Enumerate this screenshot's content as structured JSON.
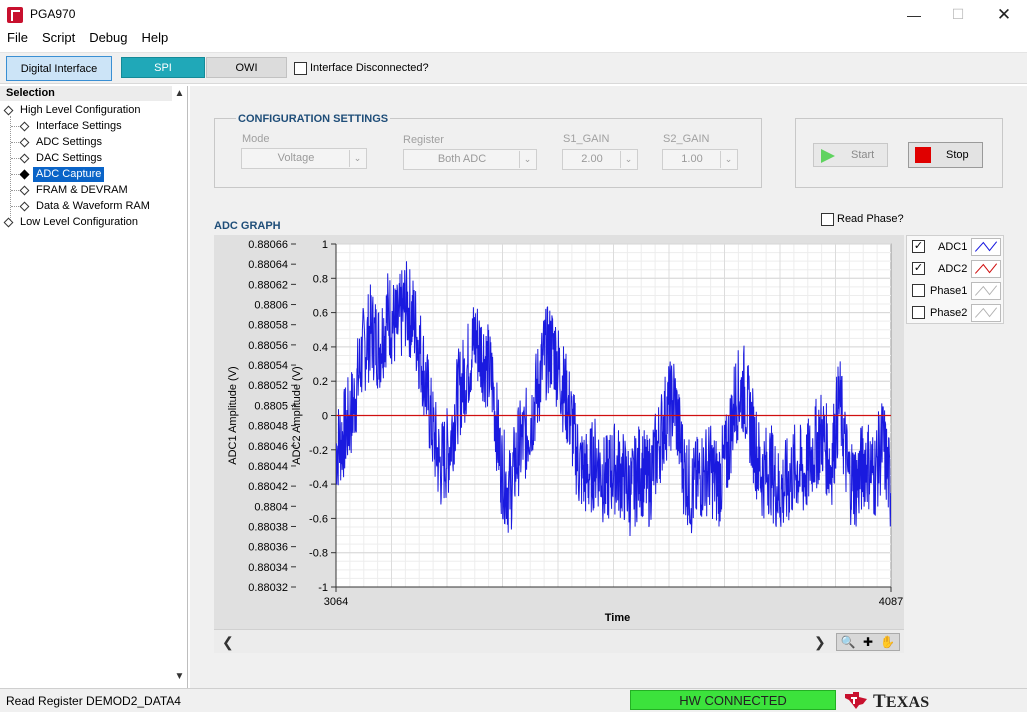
{
  "window": {
    "title": "PGA970"
  },
  "menu": [
    "File",
    "Script",
    "Debug",
    "Help"
  ],
  "toolbar": {
    "digital_interface": "Digital Interface",
    "spi": "SPI",
    "owi": "OWI",
    "interface_disconnected": "Interface Disconnected?",
    "interface_disconnected_checked": false
  },
  "sidebar": {
    "header": "Selection",
    "items": [
      {
        "label": "High Level Configuration",
        "level": 0
      },
      {
        "label": "Interface Settings",
        "level": 1
      },
      {
        "label": "ADC Settings",
        "level": 1
      },
      {
        "label": "DAC Settings",
        "level": 1
      },
      {
        "label": "ADC Capture",
        "level": 1,
        "selected": true
      },
      {
        "label": "FRAM & DEVRAM",
        "level": 1
      },
      {
        "label": "Data & Waveform RAM",
        "level": 1
      },
      {
        "label": "Low Level Configuration",
        "level": 0
      }
    ]
  },
  "config": {
    "title": "CONFIGURATION SETTINGS",
    "mode_label": "Mode",
    "mode_value": "Voltage",
    "register_label": "Register",
    "register_value": "Both ADC",
    "s1_gain_label": "S1_GAIN",
    "s1_gain_value": "2.00",
    "s2_gain_label": "S2_GAIN",
    "s2_gain_value": "1.00"
  },
  "actions": {
    "start": "Start",
    "stop": "Stop"
  },
  "graph": {
    "title": "ADC GRAPH",
    "read_phase": "Read Phase?",
    "legend": [
      {
        "name": "ADC1",
        "checked": true,
        "color": "#1a1adf"
      },
      {
        "name": "ADC2",
        "checked": true,
        "color": "#d01010"
      },
      {
        "name": "Phase1",
        "checked": false,
        "color": "#b0b0b0"
      },
      {
        "name": "Phase2",
        "checked": false,
        "color": "#b0b0b0"
      }
    ]
  },
  "chart_data": {
    "type": "line",
    "xlabel": "Time",
    "ylabel_left": "ADC1 Amplitude (V)",
    "ylabel_right": "ADC2 Amplitude (V)",
    "xlim": [
      3064,
      4087
    ],
    "x_ticks": [
      "3064",
      "4087"
    ],
    "ylim_left": [
      0.88032,
      0.88066
    ],
    "y_ticks_left": [
      "0.88066",
      "0.88064",
      "0.88062",
      "0.8806",
      "0.88058",
      "0.88056",
      "0.88054",
      "0.88052",
      "0.8805",
      "0.88048",
      "0.88046",
      "0.88044",
      "0.88042",
      "0.8804",
      "0.88038",
      "0.88036",
      "0.88034",
      "0.88032"
    ],
    "ylim_right": [
      -1,
      1
    ],
    "y_ticks_right": [
      "1",
      "0.8",
      "0.6",
      "0.4",
      "0.2",
      "0",
      "-0.2",
      "-0.4",
      "-0.6",
      "-0.8",
      "-1"
    ],
    "grid": true,
    "series": [
      {
        "name": "ADC1",
        "axis": "right",
        "color": "#1a1adf",
        "x": [
          3064,
          3080,
          3096,
          3112,
          3128,
          3144,
          3160,
          3176,
          3192,
          3208,
          3224,
          3240,
          3256,
          3272,
          3288,
          3304,
          3320,
          3336,
          3352,
          3368,
          3384,
          3400,
          3416,
          3432,
          3448,
          3464,
          3480,
          3496,
          3512,
          3528,
          3544,
          3560,
          3576,
          3592,
          3608,
          3624,
          3640,
          3656,
          3672,
          3688,
          3704,
          3720,
          3736,
          3752,
          3768,
          3784,
          3800,
          3816,
          3832,
          3848,
          3864,
          3880,
          3896,
          3912,
          3928,
          3944,
          3960,
          3976,
          3992,
          4008,
          4024,
          4040,
          4056,
          4072,
          4087
        ],
        "values": [
          -0.2,
          -0.1,
          0.05,
          0.35,
          0.5,
          0.4,
          0.6,
          0.5,
          0.65,
          0.55,
          0.3,
          -0.05,
          -0.3,
          -0.2,
          0.1,
          0.25,
          0.45,
          0.35,
          0.2,
          -0.3,
          -0.45,
          -0.2,
          -0.1,
          0.1,
          0.35,
          0.4,
          0.2,
          0.0,
          -0.3,
          -0.35,
          -0.25,
          -0.4,
          -0.3,
          -0.35,
          -0.45,
          -0.3,
          -0.4,
          -0.2,
          0.0,
          0.1,
          -0.3,
          -0.45,
          -0.35,
          -0.3,
          -0.4,
          -0.25,
          0.1,
          0.15,
          -0.1,
          -0.35,
          -0.3,
          -0.45,
          -0.4,
          -0.3,
          -0.35,
          -0.2,
          -0.1,
          -0.3,
          0.1,
          -0.35,
          -0.4,
          -0.25,
          -0.35,
          -0.15,
          -0.45
        ]
      },
      {
        "name": "ADC2",
        "axis": "right",
        "color": "#d01010",
        "x": [
          3064,
          4087
        ],
        "values": [
          0,
          0
        ]
      }
    ]
  },
  "statusbar": {
    "message": "Read Register DEMOD2_DATA4",
    "hw_status": "HW CONNECTED",
    "brand": "Texas Instruments"
  }
}
